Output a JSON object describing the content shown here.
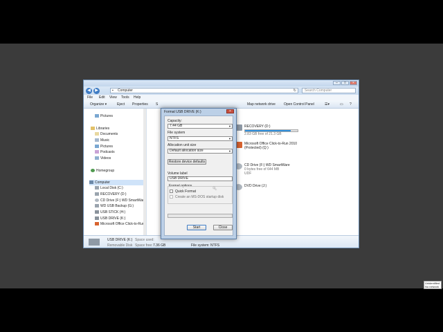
{
  "window": {
    "controls": [
      "–",
      "□",
      "×"
    ]
  },
  "address": {
    "crumb": "Computer",
    "search_placeholder": "Search Computer"
  },
  "menu": [
    "File",
    "Edit",
    "View",
    "Tools",
    "Help"
  ],
  "commands": [
    "Organize ▾",
    "Eject",
    "Properties",
    "S",
    "Map network drive",
    "Open Control Panel"
  ],
  "nav": {
    "pictures": "Pictures",
    "libraries": "Libraries",
    "documents": "Documents",
    "music": "Music",
    "pictures2": "Pictures",
    "podcasts": "Podcasts",
    "videos": "Videos",
    "homegroup": "Homegroup",
    "computer": "Computer",
    "local_disk": "Local Disk (C:)",
    "recovery": "RECOVERY (D:)",
    "cd_drive": "CD Drive (F:) WD SmartWare",
    "wd_backup": "WD USB Backup (G:)",
    "usb_stick": "USB STICK (H:)",
    "usb_drive": "USB DRIVE (K:)",
    "office": "Microsoft Office Click-to-Run"
  },
  "drives": {
    "recovery_name": "RECOVERY (D:)",
    "recovery_free": "2.83 GB free of 21.3 GB",
    "recovery_used": 0.87,
    "office_name": "Microsoft Office Click-to-Run 2010",
    "office_sub": "(Protected) (Q:)",
    "cd_name": "CD Drive (F:) WD SmartWare",
    "cd_free": "0 bytes free of 644 MB",
    "cd_fs": "UDF",
    "dvd_name": "DVD Drive (J:)"
  },
  "status": {
    "name": "USB DRIVE (K:)",
    "type": "Removable Disk",
    "space_used": "Space used:",
    "space_free": "Space free:",
    "free_value": "7.36 GB",
    "filesystem": "File system: NTFS"
  },
  "dialog": {
    "title": "Format USB DRIVE (K:)",
    "close": "×",
    "capacity_label": "Capacity:",
    "capacity_value": "7.44 GB",
    "fs_label": "File system",
    "fs_value": "NTFS",
    "alloc_label": "Allocation unit size",
    "alloc_value": "Default allocation size",
    "restore_btn": "Restore device defaults",
    "volume_label": "Volume label",
    "volume_value": "USB DRIVE",
    "options_label": "Format options",
    "quick_format": "Quick Format",
    "msdos_disk": "Create an MS-DOS startup disk",
    "start_btn": "Start",
    "close_btn": "Close"
  },
  "tip": {
    "line1": "Unidentified",
    "line2": "No network"
  },
  "colors": {
    "accent": "#2f8fdc",
    "titlebar": "#c3d6ec",
    "dialog_frame": "#bcd0e7"
  }
}
